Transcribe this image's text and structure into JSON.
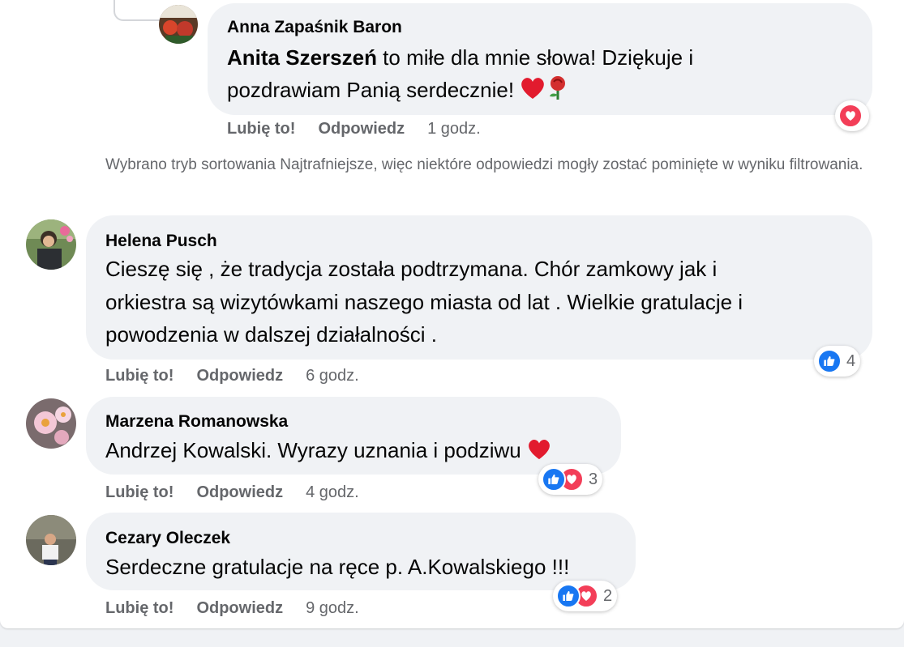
{
  "comments": [
    {
      "author": "Anna Zapaśnik Baron",
      "mention": "Anita Szerszeń",
      "text_line1": " to miłe dla mnie słowa! Dziękuje i",
      "text_line2": "pozdrawiam Panią serdecznie!",
      "like_label": "Lubię to!",
      "reply_label": "Odpowiedz",
      "time": "1 godz.",
      "reactions": [
        "love"
      ]
    },
    {
      "author": "Helena Pusch",
      "text_line1": "Cieszę się , że tradycja została podtrzymana. Chór zamkowy jak i",
      "text_line2": "orkiestra są wizytówkami naszego miasta od lat . Wielkie gratulacje i",
      "text_line3": "powodzenia w dalszej działalności .",
      "like_label": "Lubię to!",
      "reply_label": "Odpowiedz",
      "time": "6 godz.",
      "reactions": [
        "like"
      ],
      "reaction_count": "4"
    },
    {
      "author": "Marzena Romanowska",
      "text_line1": "Andrzej Kowalski. Wyrazy uznania i podziwu",
      "like_label": "Lubię to!",
      "reply_label": "Odpowiedz",
      "time": "4 godz.",
      "reactions": [
        "like",
        "love"
      ],
      "reaction_count": "3"
    },
    {
      "author": "Cezary Oleczek",
      "text_line1": "Serdeczne gratulacje na ręce p. A.Kowalskiego !!!",
      "like_label": "Lubię to!",
      "reply_label": "Odpowiedz",
      "time": "9 godz.",
      "reactions": [
        "like",
        "love"
      ],
      "reaction_count": "2"
    }
  ],
  "sort_notice": "Wybrano tryb sortowania Najtrafniejsze, więc niektóre odpowiedzi mogły zostać pominięte w wyniku filtrowania.",
  "colors": {
    "bubble": "#f0f2f5",
    "secondary_text": "#65676b",
    "like_blue": "#1877f2",
    "love_red": "#f33e58"
  }
}
